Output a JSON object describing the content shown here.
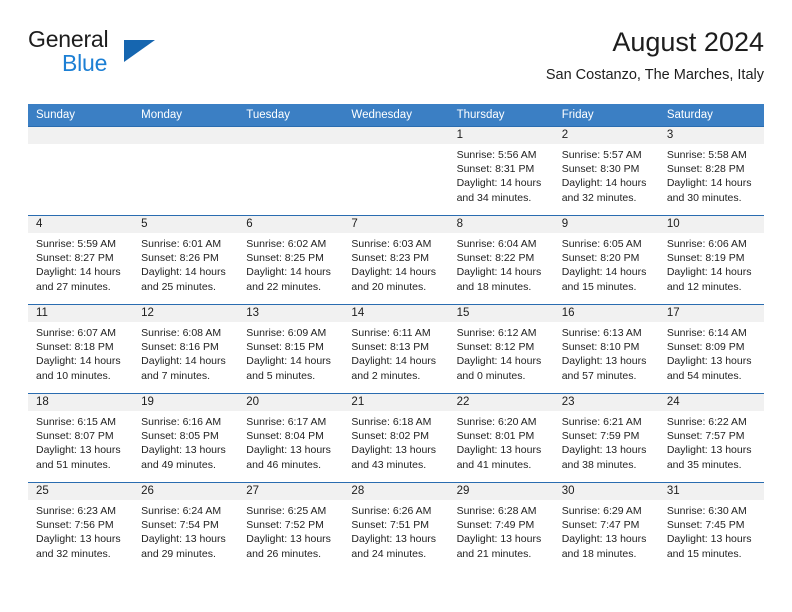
{
  "brand": {
    "line1": "General",
    "line2": "Blue",
    "triangle_color": "#1666b0",
    "blue_color": "#1c7fd4"
  },
  "header": {
    "title": "August 2024",
    "subtitle": "San Costanzo, The Marches, Italy"
  },
  "theme": {
    "header_blue": "#3b7fc4",
    "row_divider": "#2a6cb0",
    "daynum_bg": "#f1f1f1"
  },
  "weekdays": [
    "Sunday",
    "Monday",
    "Tuesday",
    "Wednesday",
    "Thursday",
    "Friday",
    "Saturday"
  ],
  "weeks": [
    [
      {
        "day": "",
        "sunrise": "",
        "sunset": "",
        "daylight1": "",
        "daylight2": ""
      },
      {
        "day": "",
        "sunrise": "",
        "sunset": "",
        "daylight1": "",
        "daylight2": ""
      },
      {
        "day": "",
        "sunrise": "",
        "sunset": "",
        "daylight1": "",
        "daylight2": ""
      },
      {
        "day": "",
        "sunrise": "",
        "sunset": "",
        "daylight1": "",
        "daylight2": ""
      },
      {
        "day": "1",
        "sunrise": "Sunrise: 5:56 AM",
        "sunset": "Sunset: 8:31 PM",
        "daylight1": "Daylight: 14 hours",
        "daylight2": "and 34 minutes."
      },
      {
        "day": "2",
        "sunrise": "Sunrise: 5:57 AM",
        "sunset": "Sunset: 8:30 PM",
        "daylight1": "Daylight: 14 hours",
        "daylight2": "and 32 minutes."
      },
      {
        "day": "3",
        "sunrise": "Sunrise: 5:58 AM",
        "sunset": "Sunset: 8:28 PM",
        "daylight1": "Daylight: 14 hours",
        "daylight2": "and 30 minutes."
      }
    ],
    [
      {
        "day": "4",
        "sunrise": "Sunrise: 5:59 AM",
        "sunset": "Sunset: 8:27 PM",
        "daylight1": "Daylight: 14 hours",
        "daylight2": "and 27 minutes."
      },
      {
        "day": "5",
        "sunrise": "Sunrise: 6:01 AM",
        "sunset": "Sunset: 8:26 PM",
        "daylight1": "Daylight: 14 hours",
        "daylight2": "and 25 minutes."
      },
      {
        "day": "6",
        "sunrise": "Sunrise: 6:02 AM",
        "sunset": "Sunset: 8:25 PM",
        "daylight1": "Daylight: 14 hours",
        "daylight2": "and 22 minutes."
      },
      {
        "day": "7",
        "sunrise": "Sunrise: 6:03 AM",
        "sunset": "Sunset: 8:23 PM",
        "daylight1": "Daylight: 14 hours",
        "daylight2": "and 20 minutes."
      },
      {
        "day": "8",
        "sunrise": "Sunrise: 6:04 AM",
        "sunset": "Sunset: 8:22 PM",
        "daylight1": "Daylight: 14 hours",
        "daylight2": "and 18 minutes."
      },
      {
        "day": "9",
        "sunrise": "Sunrise: 6:05 AM",
        "sunset": "Sunset: 8:20 PM",
        "daylight1": "Daylight: 14 hours",
        "daylight2": "and 15 minutes."
      },
      {
        "day": "10",
        "sunrise": "Sunrise: 6:06 AM",
        "sunset": "Sunset: 8:19 PM",
        "daylight1": "Daylight: 14 hours",
        "daylight2": "and 12 minutes."
      }
    ],
    [
      {
        "day": "11",
        "sunrise": "Sunrise: 6:07 AM",
        "sunset": "Sunset: 8:18 PM",
        "daylight1": "Daylight: 14 hours",
        "daylight2": "and 10 minutes."
      },
      {
        "day": "12",
        "sunrise": "Sunrise: 6:08 AM",
        "sunset": "Sunset: 8:16 PM",
        "daylight1": "Daylight: 14 hours",
        "daylight2": "and 7 minutes."
      },
      {
        "day": "13",
        "sunrise": "Sunrise: 6:09 AM",
        "sunset": "Sunset: 8:15 PM",
        "daylight1": "Daylight: 14 hours",
        "daylight2": "and 5 minutes."
      },
      {
        "day": "14",
        "sunrise": "Sunrise: 6:11 AM",
        "sunset": "Sunset: 8:13 PM",
        "daylight1": "Daylight: 14 hours",
        "daylight2": "and 2 minutes."
      },
      {
        "day": "15",
        "sunrise": "Sunrise: 6:12 AM",
        "sunset": "Sunset: 8:12 PM",
        "daylight1": "Daylight: 14 hours",
        "daylight2": "and 0 minutes."
      },
      {
        "day": "16",
        "sunrise": "Sunrise: 6:13 AM",
        "sunset": "Sunset: 8:10 PM",
        "daylight1": "Daylight: 13 hours",
        "daylight2": "and 57 minutes."
      },
      {
        "day": "17",
        "sunrise": "Sunrise: 6:14 AM",
        "sunset": "Sunset: 8:09 PM",
        "daylight1": "Daylight: 13 hours",
        "daylight2": "and 54 minutes."
      }
    ],
    [
      {
        "day": "18",
        "sunrise": "Sunrise: 6:15 AM",
        "sunset": "Sunset: 8:07 PM",
        "daylight1": "Daylight: 13 hours",
        "daylight2": "and 51 minutes."
      },
      {
        "day": "19",
        "sunrise": "Sunrise: 6:16 AM",
        "sunset": "Sunset: 8:05 PM",
        "daylight1": "Daylight: 13 hours",
        "daylight2": "and 49 minutes."
      },
      {
        "day": "20",
        "sunrise": "Sunrise: 6:17 AM",
        "sunset": "Sunset: 8:04 PM",
        "daylight1": "Daylight: 13 hours",
        "daylight2": "and 46 minutes."
      },
      {
        "day": "21",
        "sunrise": "Sunrise: 6:18 AM",
        "sunset": "Sunset: 8:02 PM",
        "daylight1": "Daylight: 13 hours",
        "daylight2": "and 43 minutes."
      },
      {
        "day": "22",
        "sunrise": "Sunrise: 6:20 AM",
        "sunset": "Sunset: 8:01 PM",
        "daylight1": "Daylight: 13 hours",
        "daylight2": "and 41 minutes."
      },
      {
        "day": "23",
        "sunrise": "Sunrise: 6:21 AM",
        "sunset": "Sunset: 7:59 PM",
        "daylight1": "Daylight: 13 hours",
        "daylight2": "and 38 minutes."
      },
      {
        "day": "24",
        "sunrise": "Sunrise: 6:22 AM",
        "sunset": "Sunset: 7:57 PM",
        "daylight1": "Daylight: 13 hours",
        "daylight2": "and 35 minutes."
      }
    ],
    [
      {
        "day": "25",
        "sunrise": "Sunrise: 6:23 AM",
        "sunset": "Sunset: 7:56 PM",
        "daylight1": "Daylight: 13 hours",
        "daylight2": "and 32 minutes."
      },
      {
        "day": "26",
        "sunrise": "Sunrise: 6:24 AM",
        "sunset": "Sunset: 7:54 PM",
        "daylight1": "Daylight: 13 hours",
        "daylight2": "and 29 minutes."
      },
      {
        "day": "27",
        "sunrise": "Sunrise: 6:25 AM",
        "sunset": "Sunset: 7:52 PM",
        "daylight1": "Daylight: 13 hours",
        "daylight2": "and 26 minutes."
      },
      {
        "day": "28",
        "sunrise": "Sunrise: 6:26 AM",
        "sunset": "Sunset: 7:51 PM",
        "daylight1": "Daylight: 13 hours",
        "daylight2": "and 24 minutes."
      },
      {
        "day": "29",
        "sunrise": "Sunrise: 6:28 AM",
        "sunset": "Sunset: 7:49 PM",
        "daylight1": "Daylight: 13 hours",
        "daylight2": "and 21 minutes."
      },
      {
        "day": "30",
        "sunrise": "Sunrise: 6:29 AM",
        "sunset": "Sunset: 7:47 PM",
        "daylight1": "Daylight: 13 hours",
        "daylight2": "and 18 minutes."
      },
      {
        "day": "31",
        "sunrise": "Sunrise: 6:30 AM",
        "sunset": "Sunset: 7:45 PM",
        "daylight1": "Daylight: 13 hours",
        "daylight2": "and 15 minutes."
      }
    ]
  ]
}
